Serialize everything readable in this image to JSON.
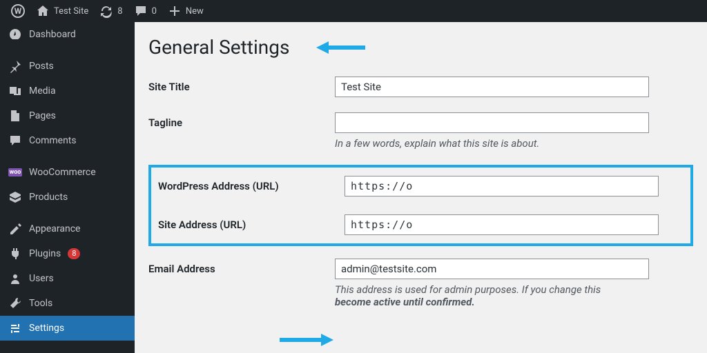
{
  "toolbar": {
    "site_name": "Test Site",
    "updates": "8",
    "comments": "0",
    "new_label": "New"
  },
  "sidebar": {
    "items": [
      {
        "label": "Dashboard"
      },
      {
        "label": "Posts"
      },
      {
        "label": "Media"
      },
      {
        "label": "Pages"
      },
      {
        "label": "Comments"
      },
      {
        "label": "WooCommerce"
      },
      {
        "label": "Products"
      },
      {
        "label": "Appearance"
      },
      {
        "label": "Plugins",
        "badge": "8"
      },
      {
        "label": "Users"
      },
      {
        "label": "Tools"
      },
      {
        "label": "Settings"
      }
    ]
  },
  "page": {
    "heading": "General Settings",
    "fields": {
      "site_title": {
        "label": "Site Title",
        "value": "Test Site"
      },
      "tagline": {
        "label": "Tagline",
        "value": "",
        "description": "In a few words, explain what this site is about."
      },
      "wp_url": {
        "label": "WordPress Address (URL)",
        "value": "https://o"
      },
      "site_url": {
        "label": "Site Address (URL)",
        "value": "https://o"
      },
      "email": {
        "label": "Email Address",
        "value": "admin@testsite.com",
        "description_a": "This address is used for admin purposes. If you change this",
        "description_b": "become active until confirmed."
      }
    }
  }
}
